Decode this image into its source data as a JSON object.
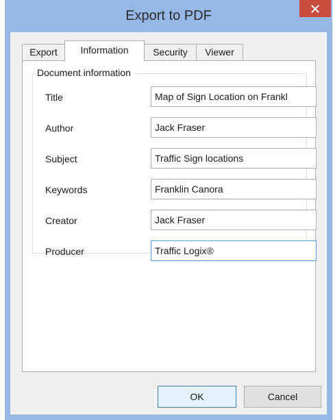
{
  "window": {
    "title": "Export to PDF",
    "close_icon": "close-icon"
  },
  "tabs": [
    {
      "label": "Export",
      "active": false
    },
    {
      "label": "Information",
      "active": true
    },
    {
      "label": "Security",
      "active": false
    },
    {
      "label": "Viewer",
      "active": false
    }
  ],
  "group": {
    "legend": "Document information"
  },
  "fields": {
    "title": {
      "label": "Title",
      "value": "Map of Sign Location on Frankl"
    },
    "author": {
      "label": "Author",
      "value": "Jack Fraser"
    },
    "subject": {
      "label": "Subject",
      "value": "Traffic Sign locations"
    },
    "keywords": {
      "label": "Keywords",
      "value": "Franklin Canora"
    },
    "creator": {
      "label": "Creator",
      "value": "Jack Fraser"
    },
    "producer": {
      "label": "Producer",
      "value": "Traffic Logix®"
    }
  },
  "buttons": {
    "ok": "OK",
    "cancel": "Cancel"
  },
  "colors": {
    "frame": "#95b8e7",
    "close": "#c94c3c",
    "client": "#f0f0f0",
    "focus_border": "#569de5",
    "default_button_border": "#3c7fb1"
  }
}
